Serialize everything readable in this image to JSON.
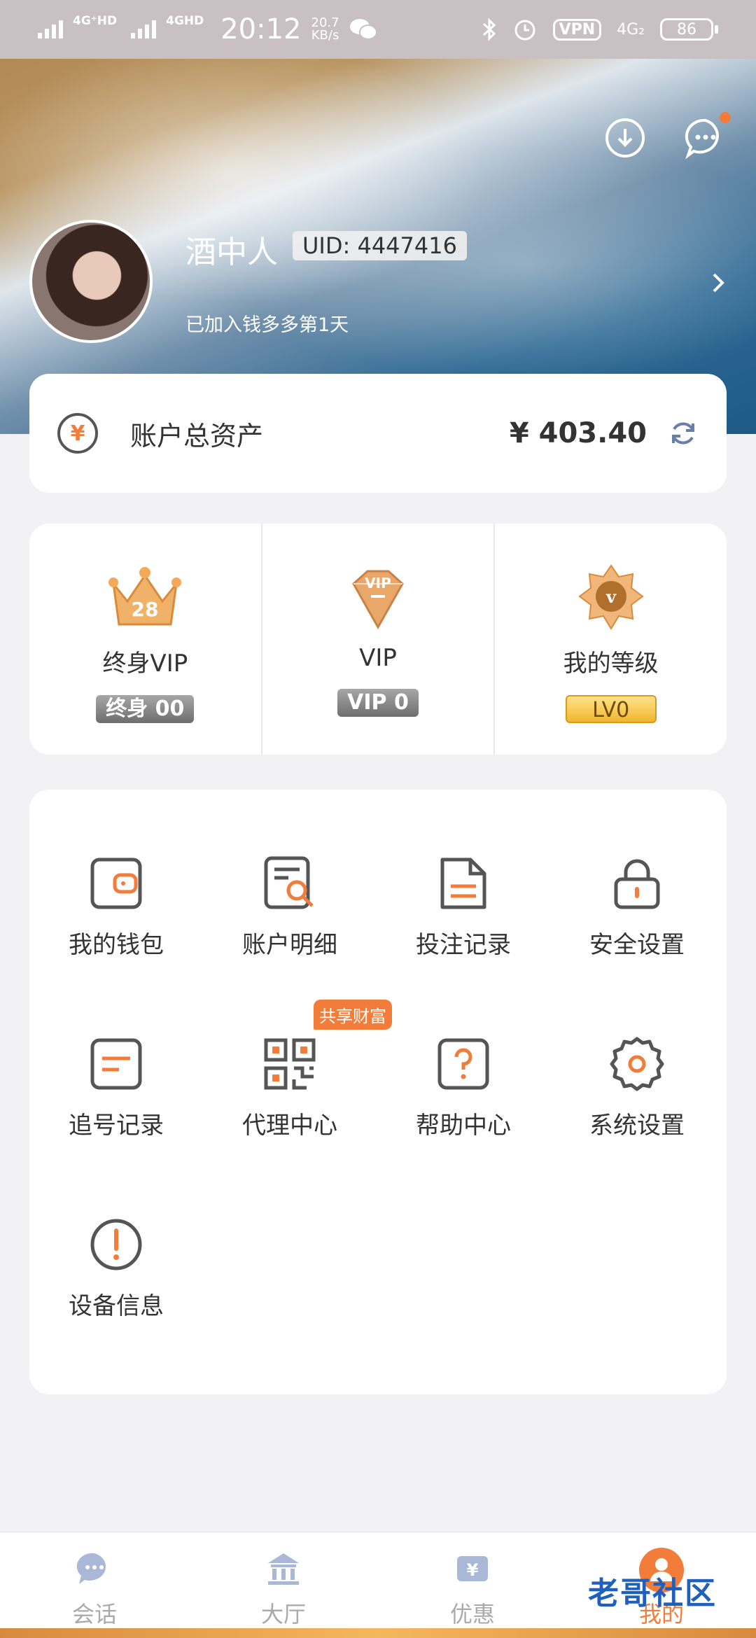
{
  "status_bar": {
    "signal1": "4G⁺HD",
    "signal2": "4GHD",
    "time": "20:12",
    "speed_value": "20.7",
    "speed_unit": "KB/s",
    "vpn": "VPN",
    "network": "4G₂",
    "battery": "86"
  },
  "profile": {
    "name": "酒中人",
    "uid": "UID: 4447416",
    "joined": "已加入钱多多第1天"
  },
  "assets": {
    "label": "账户总资产",
    "value": "¥ 403.40",
    "icon": "yen-icon"
  },
  "vip": [
    {
      "title": "终身VIP",
      "badge": "终身 00",
      "icon": "crown-28-icon"
    },
    {
      "title": "VIP",
      "badge": "VIP 0",
      "icon": "vip-diamond-icon"
    },
    {
      "title": "我的等级",
      "badge": "LV0",
      "icon": "level-star-icon"
    }
  ],
  "menu": [
    {
      "label": "我的钱包",
      "icon": "wallet-icon"
    },
    {
      "label": "账户明细",
      "icon": "account-detail-icon"
    },
    {
      "label": "投注记录",
      "icon": "bet-record-icon"
    },
    {
      "label": "安全设置",
      "icon": "lock-icon"
    },
    {
      "label": "追号记录",
      "icon": "chase-record-icon"
    },
    {
      "label": "代理中心",
      "icon": "qr-code-icon",
      "tag": "共享财富"
    },
    {
      "label": "帮助中心",
      "icon": "help-icon"
    },
    {
      "label": "系统设置",
      "icon": "gear-icon"
    },
    {
      "label": "设备信息",
      "icon": "info-icon"
    }
  ],
  "nav": [
    {
      "label": "会话",
      "icon": "chat-icon"
    },
    {
      "label": "大厅",
      "icon": "hall-icon"
    },
    {
      "label": "优惠",
      "icon": "discount-icon"
    },
    {
      "label": "我的",
      "icon": "profile-icon",
      "active": true
    }
  ],
  "watermark": "老哥社区",
  "colors": {
    "accent": "#f27d3b",
    "header_sea": "#1d5a86",
    "sand": "#b28a55"
  }
}
